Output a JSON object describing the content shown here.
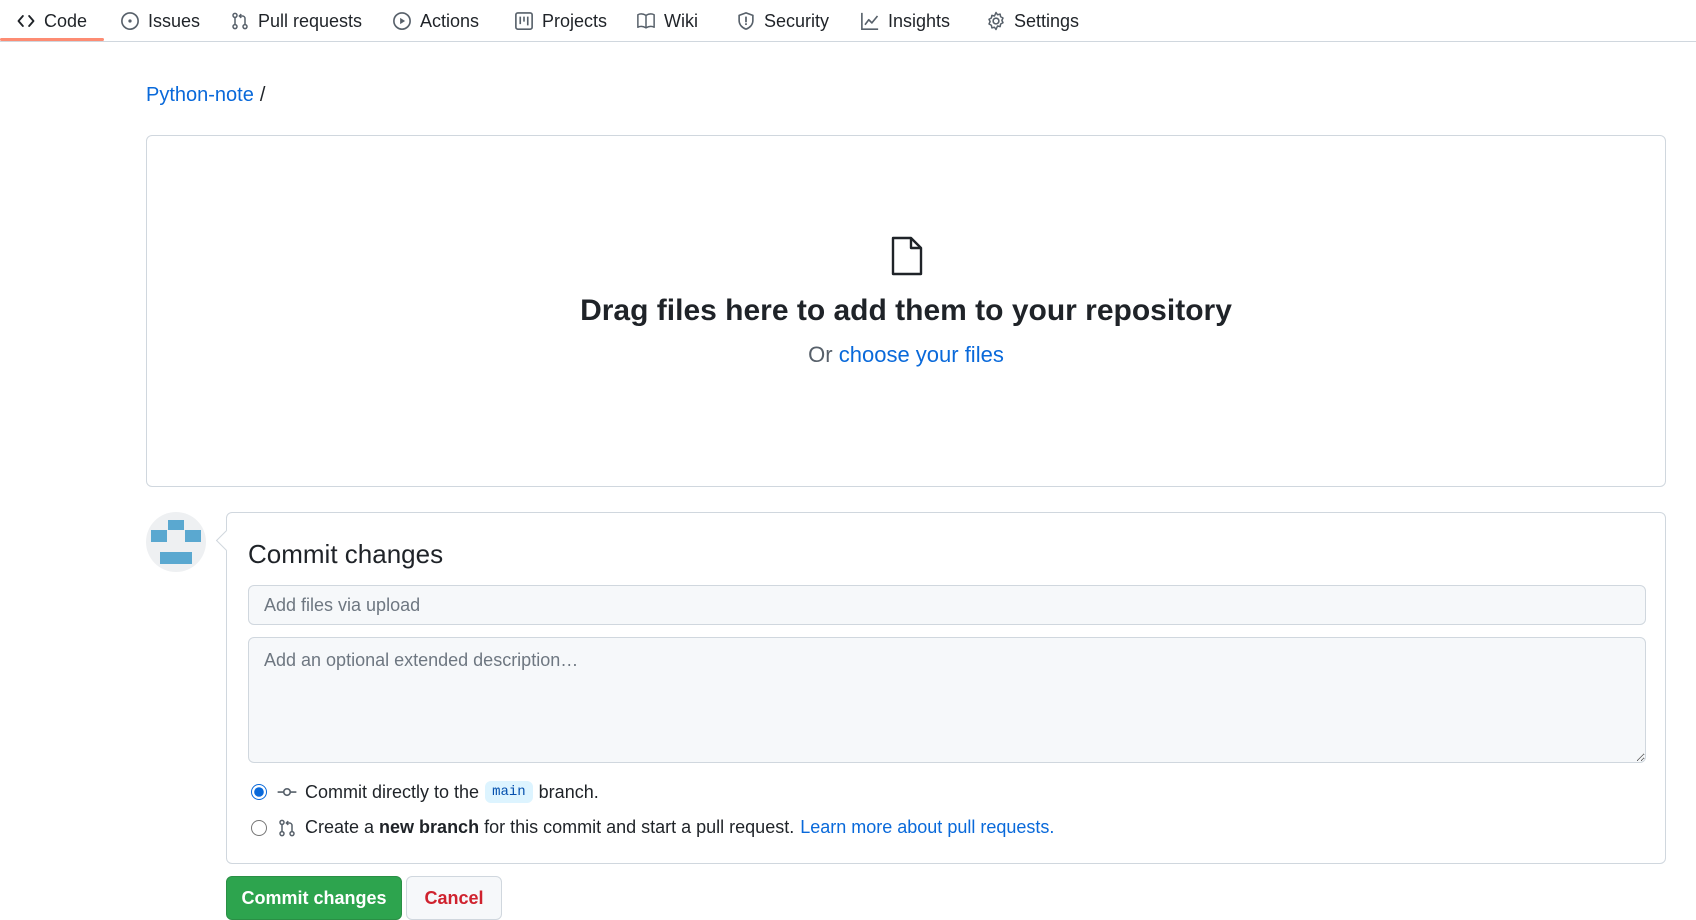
{
  "nav": {
    "items": [
      {
        "label": "Code",
        "icon": "code-icon",
        "selected": true
      },
      {
        "label": "Issues",
        "icon": "issue-icon"
      },
      {
        "label": "Pull requests",
        "icon": "pull-request-icon"
      },
      {
        "label": "Actions",
        "icon": "play-icon"
      },
      {
        "label": "Projects",
        "icon": "project-icon"
      },
      {
        "label": "Wiki",
        "icon": "book-icon"
      },
      {
        "label": "Security",
        "icon": "shield-icon"
      },
      {
        "label": "Insights",
        "icon": "graph-icon"
      },
      {
        "label": "Settings",
        "icon": "gear-icon"
      }
    ],
    "accent": "#fd8c73"
  },
  "breadcrumb": {
    "repo": "Python-note",
    "separator": "/"
  },
  "dropzone": {
    "icon": "file-icon",
    "title": "Drag files here to add them to your repository",
    "prefix": "Or",
    "link": "choose your files"
  },
  "commit": {
    "title": "Commit changes",
    "summary_placeholder": "Add files via upload",
    "description_placeholder": "Add an optional extended description…",
    "option_direct": {
      "prefix": "Commit directly to the",
      "branch": "main",
      "suffix": "branch.",
      "checked": true
    },
    "option_new_branch": {
      "prefix": "Create a",
      "bold": "new branch",
      "suffix": "for this commit and start a pull request.",
      "link": "Learn more about pull requests.",
      "checked": false
    }
  },
  "buttons": {
    "commit": "Commit changes",
    "cancel": "Cancel"
  },
  "colors": {
    "link": "#0969da",
    "primary": "#2da44e",
    "danger": "#cf222e",
    "border": "#d0d7de"
  }
}
